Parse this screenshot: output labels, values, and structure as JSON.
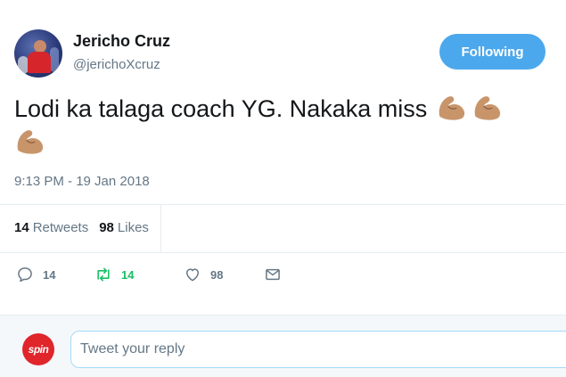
{
  "author": {
    "display_name": "Jericho Cruz",
    "handle": "@jerichoXcruz"
  },
  "follow_button": {
    "label": "Following",
    "color": "#4ca8ec"
  },
  "tweet": {
    "text": "Lodi ka talaga coach YG. Nakaka miss",
    "emoji": "flexed-biceps",
    "emoji_count": 3,
    "timestamp": "9:13 PM - 19 Jan 2018"
  },
  "stats": {
    "retweets_count": "14",
    "retweets_label": "Retweets",
    "likes_count": "98",
    "likes_label": "Likes"
  },
  "actions": {
    "reply_count": "14",
    "retweet_count": "14",
    "like_count": "98",
    "retweet_color": "#17bf63"
  },
  "reply": {
    "avatar_text": "spin",
    "placeholder": "Tweet your reply"
  }
}
